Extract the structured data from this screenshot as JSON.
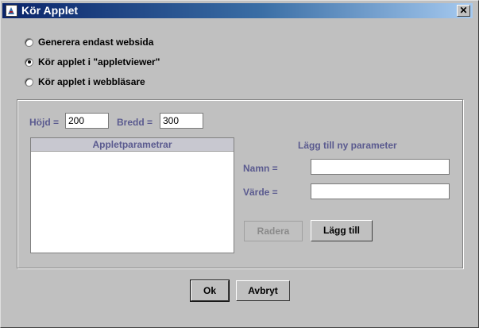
{
  "window": {
    "title": "Kör Applet",
    "close_label": "✕"
  },
  "options": [
    {
      "label": "Generera endast websida",
      "selected": false
    },
    {
      "label": "Kör applet i \"appletviewer\"",
      "selected": true
    },
    {
      "label": "Kör applet i webbläsare",
      "selected": false
    }
  ],
  "size": {
    "height_label": "Höjd =",
    "height_value": "200",
    "width_label": "Bredd =",
    "width_value": "300"
  },
  "params": {
    "list_header": "Appletparametrar",
    "new_heading": "Lägg till ny parameter",
    "name_label": "Namn =",
    "name_value": "",
    "value_label": "Värde =",
    "value_value": "",
    "remove_label": "Radera",
    "add_label": "Lägg till"
  },
  "footer": {
    "ok_label": "Ok",
    "cancel_label": "Avbryt"
  }
}
